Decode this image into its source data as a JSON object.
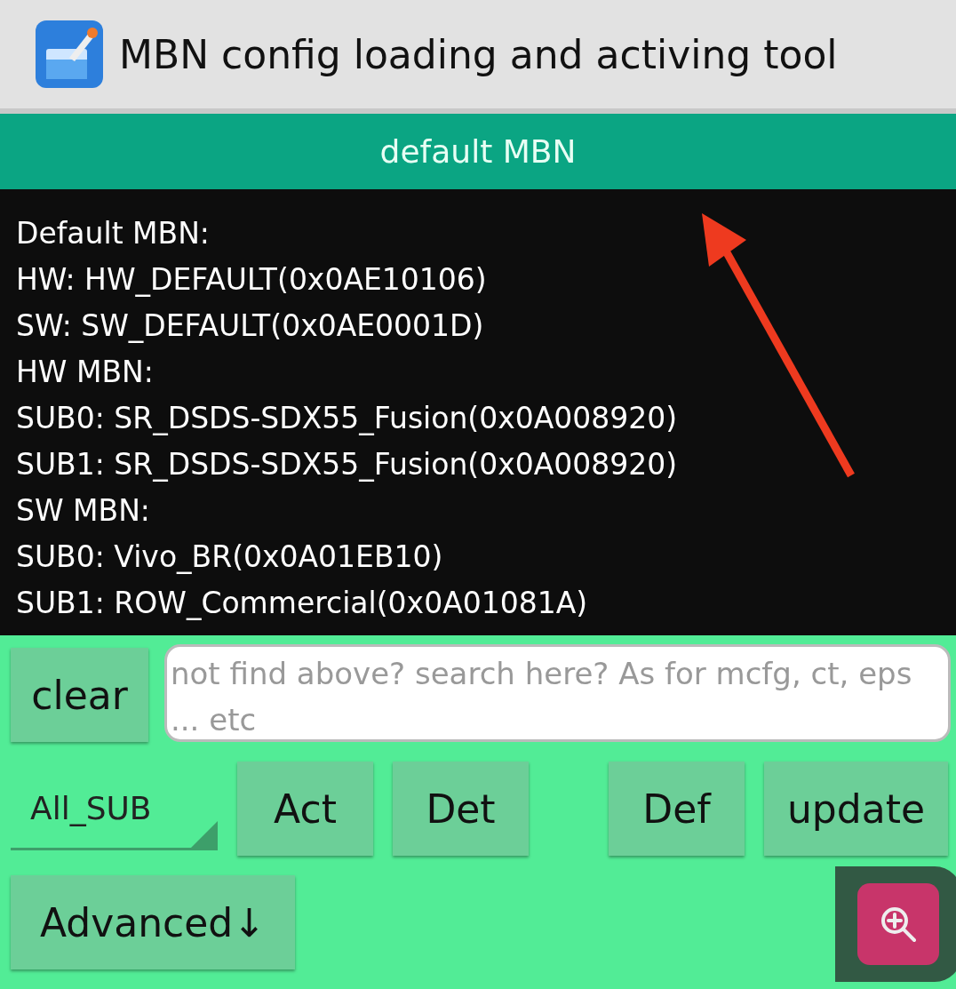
{
  "window": {
    "title": "MBN config loading and activing tool"
  },
  "header": {
    "label": "default MBN"
  },
  "info_lines": [
    "Default MBN:",
    "HW: HW_DEFAULT(0x0AE10106)",
    "SW: SW_DEFAULT(0x0AE0001D)",
    "HW MBN:",
    "SUB0: SR_DSDS-SDX55_Fusion(0x0A008920)",
    "SUB1: SR_DSDS-SDX55_Fusion(0x0A008920)",
    "SW MBN:",
    "SUB0: Vivo_BR(0x0A01EB10)",
    "SUB1: ROW_Commercial(0x0A01081A)"
  ],
  "clear_button": "clear",
  "search": {
    "placeholder": "not find above? search here? As for mcfg, ct, eps ... etc"
  },
  "sub_select": {
    "value": "All_SUB"
  },
  "buttons": [
    {
      "label": "Act",
      "gap_before": false
    },
    {
      "label": "Det",
      "gap_before": false
    },
    {
      "label": "Def",
      "gap_before": true
    },
    {
      "label": "update",
      "gap_before": false
    }
  ],
  "advanced_button": "Advanced↓"
}
